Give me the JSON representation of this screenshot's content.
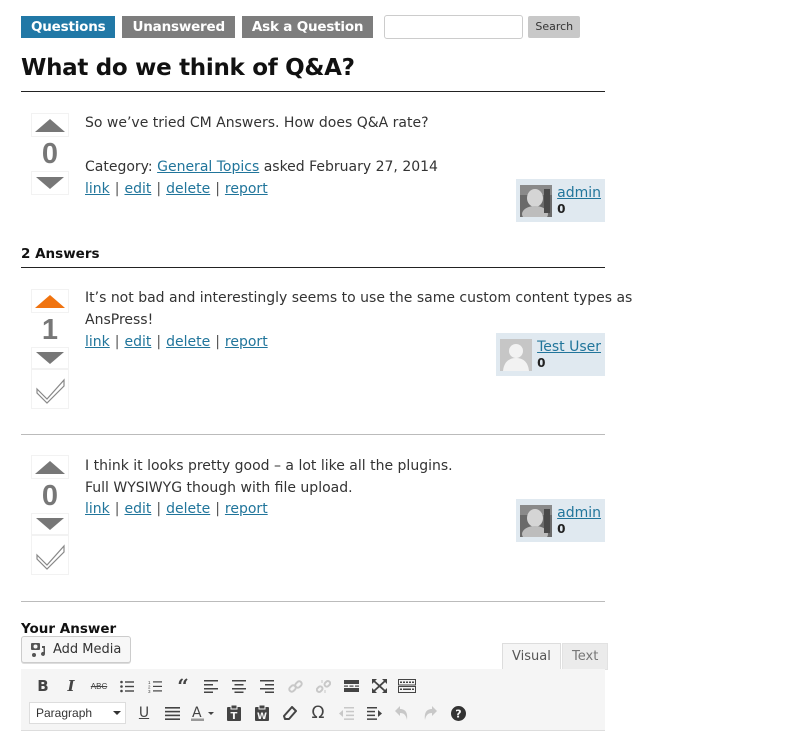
{
  "nav": {
    "tabs": [
      {
        "label": "Questions",
        "active": true
      },
      {
        "label": "Unanswered",
        "active": false
      },
      {
        "label": "Ask a Question",
        "active": false
      }
    ],
    "search_value": "",
    "search_button": "Search"
  },
  "question": {
    "title": "What do we think of Q&A?",
    "votes": "0",
    "body": "So we’ve tried CM Answers. How does Q&A rate?",
    "category_label": "Category:",
    "category": "General Topics",
    "asked_text": "asked February 27, 2014",
    "actions": [
      "link",
      "edit",
      "delete",
      "report"
    ],
    "author": {
      "name": "admin",
      "reputation": "0",
      "avatar": "photo-avatar"
    }
  },
  "answers_heading": "2 Answers",
  "answers": [
    {
      "votes": "1",
      "upvoted": true,
      "body_lines": [
        "It’s not bad and interestingly seems to use the same custom content types as",
        "AnsPress!"
      ],
      "actions": [
        "link",
        "edit",
        "delete",
        "report"
      ],
      "author": {
        "name": "Test User",
        "reputation": "0",
        "avatar": "default-avatar"
      }
    },
    {
      "votes": "0",
      "upvoted": false,
      "body_lines": [
        "I think it looks pretty good – a lot like all the plugins.",
        "Full WYSIWYG though with file upload."
      ],
      "actions": [
        "link",
        "edit",
        "delete",
        "report"
      ],
      "author": {
        "name": "admin",
        "reputation": "0",
        "avatar": "photo-avatar"
      }
    }
  ],
  "editor": {
    "heading": "Your Answer",
    "add_media": "Add Media",
    "tabs": {
      "visual": "Visual",
      "text": "Text"
    },
    "format_select": "Paragraph",
    "row1": [
      "bold-icon",
      "italic-icon",
      "strikethrough-icon",
      "bullet-list-icon",
      "numbered-list-icon",
      "blockquote-icon",
      "align-left-icon",
      "align-center-icon",
      "align-right-icon",
      "link-icon",
      "unlink-icon",
      "read-more-icon",
      "fullscreen-icon",
      "toolbar-toggle-icon"
    ],
    "row2": [
      "underline-icon",
      "justify-icon",
      "text-color-icon",
      "paste-text-icon",
      "paste-word-icon",
      "clear-formatting-icon",
      "special-character-icon",
      "outdent-icon",
      "indent-icon",
      "undo-icon",
      "redo-icon",
      "help-icon"
    ]
  },
  "colors": {
    "accent": "#2178a6",
    "link": "#21759b",
    "upvote": "#f0730f",
    "nav_inactive": "#7d7d7d",
    "author_bg": "#e0e9f0"
  }
}
